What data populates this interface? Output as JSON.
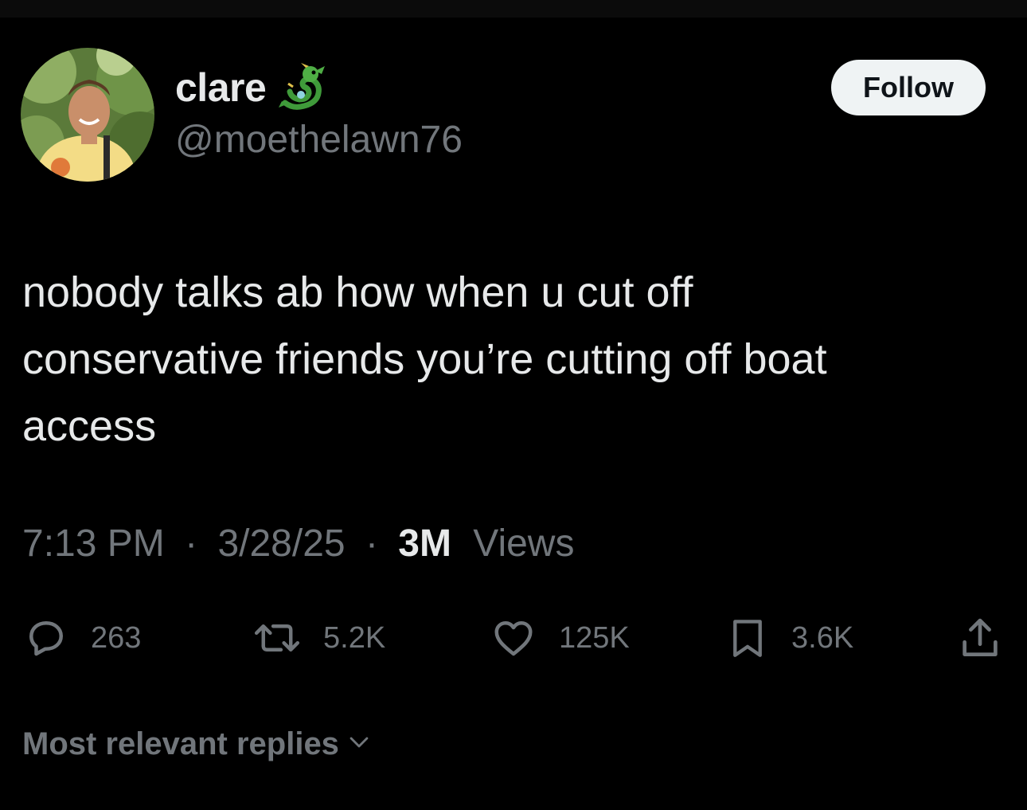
{
  "author": {
    "display_name": "clare",
    "handle": "@moethelawn76",
    "name_emoji": "dragon-icon"
  },
  "follow_label": "Follow",
  "tweet": {
    "text": "nobody talks ab how when u cut off\nconservative friends you’re cutting off boat\naccess",
    "time": "7:13 PM",
    "separator": "·",
    "date": "3/28/25",
    "views_count": "3M",
    "views_label": "Views"
  },
  "actions": {
    "replies": "263",
    "reposts": "5.2K",
    "likes": "125K",
    "bookmarks": "3.6K"
  },
  "replies_sort_label": "Most relevant replies",
  "colors": {
    "background": "#000000",
    "primary_text": "#e7e9ea",
    "secondary_text": "#71767b",
    "follow_button_bg": "#eff3f4",
    "follow_button_text": "#0f1419"
  }
}
